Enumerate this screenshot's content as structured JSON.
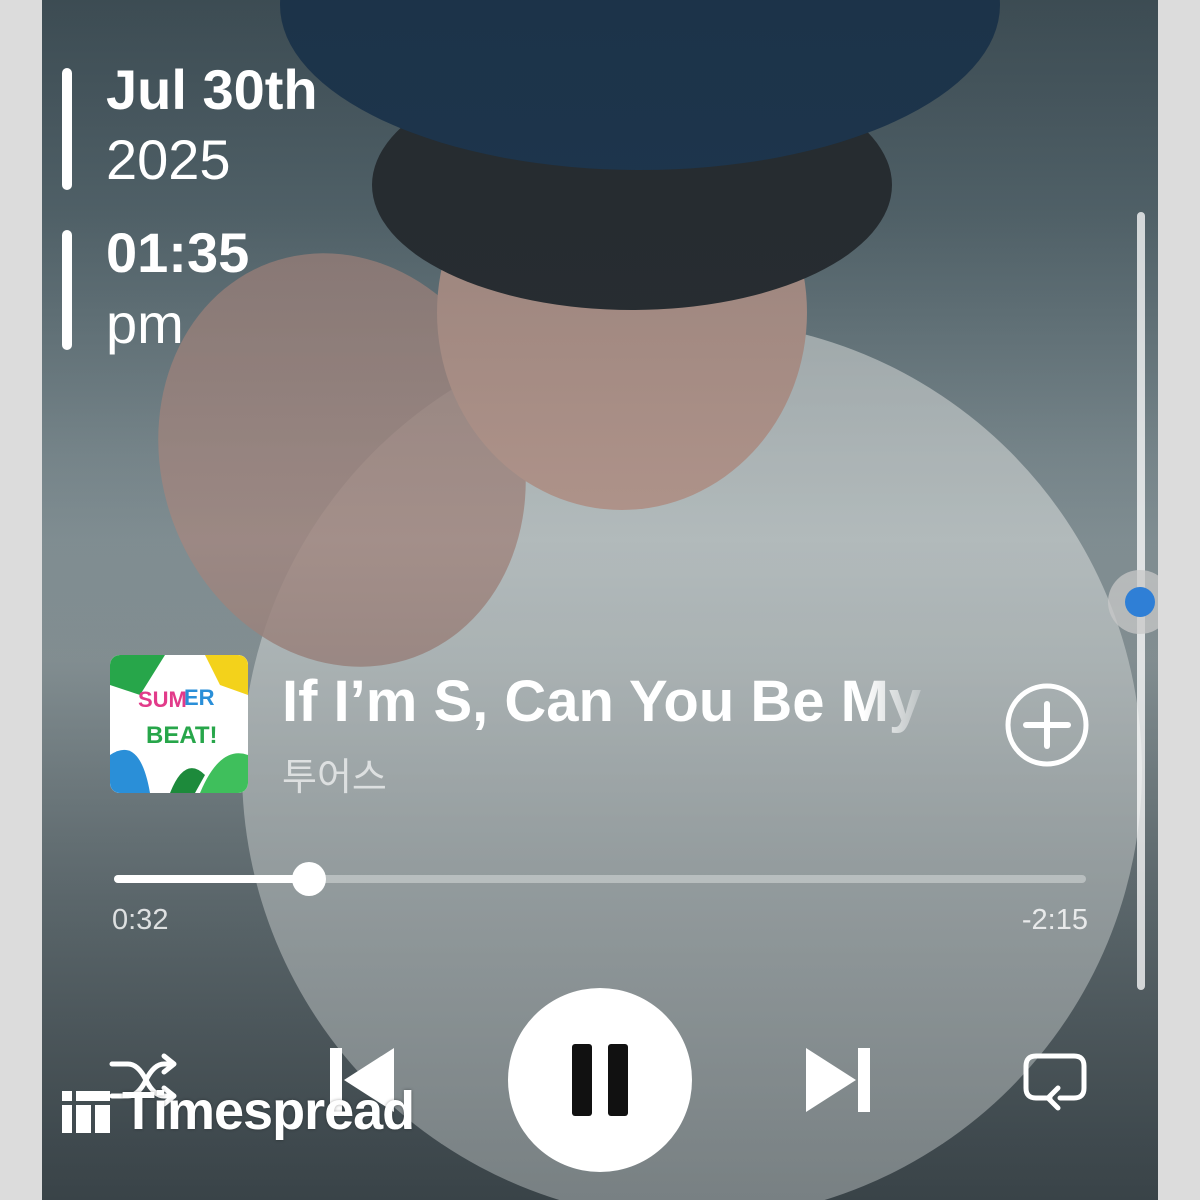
{
  "lockscreen": {
    "date_line1": "Jul 30th",
    "date_line2": "2025",
    "time_line1": "01:35",
    "time_line2": "pm"
  },
  "now_playing": {
    "title": "If I’m S, Can You Be My",
    "artist": "투어스",
    "album_art_text": "SUMMER BEAT!",
    "add_icon": "plus-circle-icon"
  },
  "progress": {
    "elapsed": "0:32",
    "remaining": "-2:15",
    "fraction": 0.201
  },
  "controls": {
    "shuffle_icon": "shuffle-icon",
    "previous_icon": "skip-previous-icon",
    "play_state_icon": "pause-icon",
    "next_icon": "skip-next-icon",
    "repeat_icon": "repeat-icon"
  },
  "scrollbar": {
    "position": 0.46,
    "accent_color": "#2f7fd6"
  },
  "watermark": {
    "text": "Timespread"
  }
}
